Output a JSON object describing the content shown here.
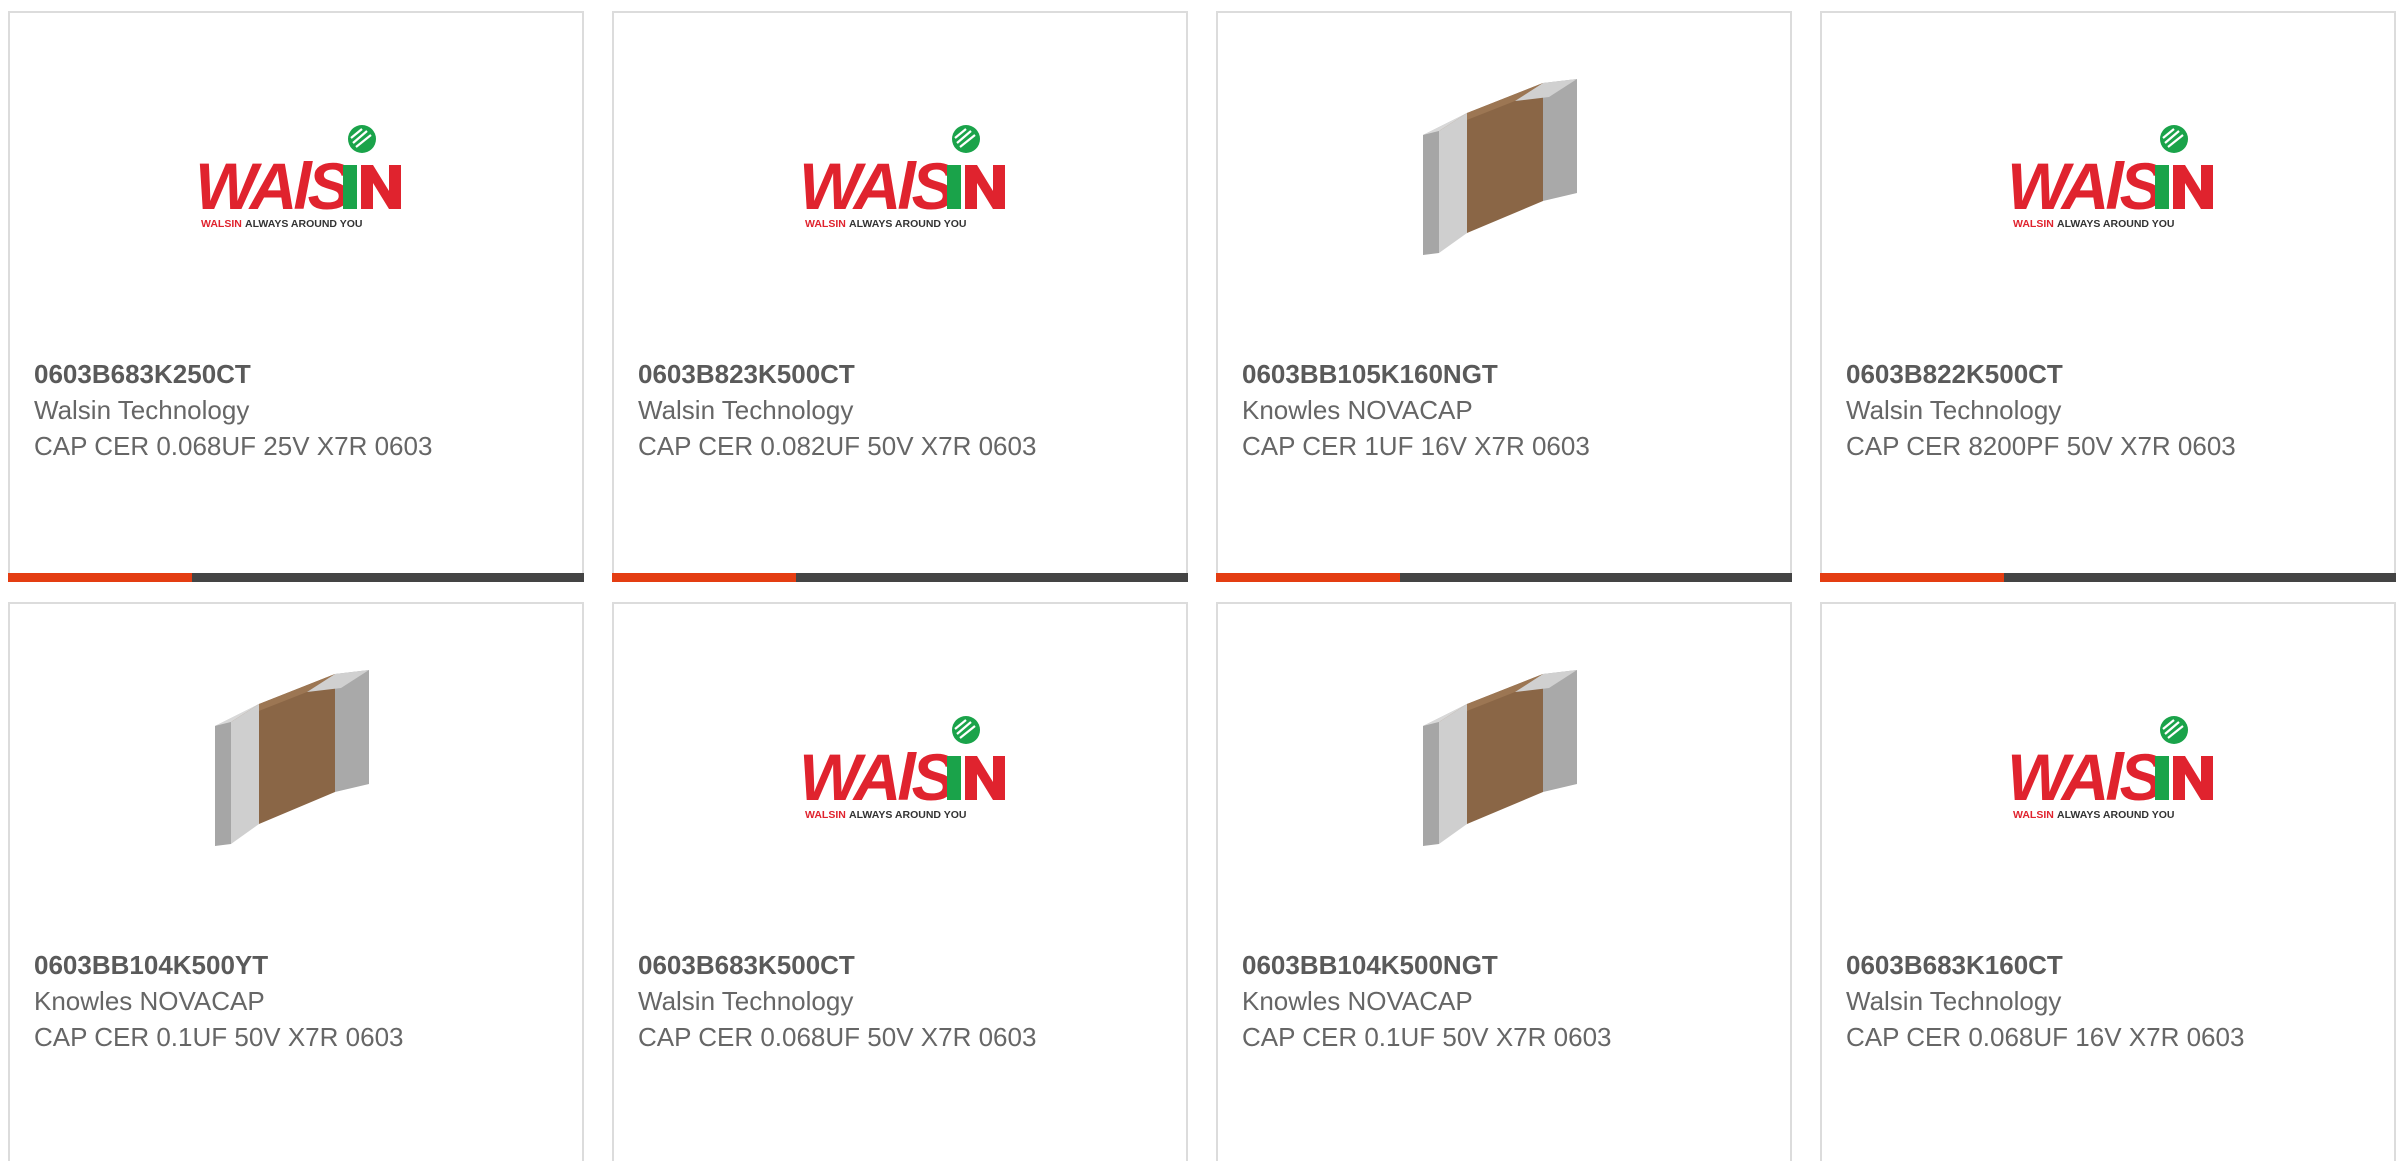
{
  "products": [
    {
      "part": "0603B683K250CT",
      "manufacturer": "Walsin Technology",
      "description": "CAP CER 0.068UF 25V X7R 0603",
      "image": "walsin-logo"
    },
    {
      "part": "0603B823K500CT",
      "manufacturer": "Walsin Technology",
      "description": "CAP CER 0.082UF 50V X7R 0603",
      "image": "walsin-logo"
    },
    {
      "part": "0603BB105K160NGT",
      "manufacturer": "Knowles NOVACAP",
      "description": "CAP CER 1UF 16V X7R 0603",
      "image": "capacitor-chip"
    },
    {
      "part": "0603B822K500CT",
      "manufacturer": "Walsin Technology",
      "description": "CAP CER 8200PF 50V X7R 0603",
      "image": "walsin-logo"
    },
    {
      "part": "0603BB104K500YT",
      "manufacturer": "Knowles NOVACAP",
      "description": "CAP CER 0.1UF 50V X7R 0603",
      "image": "capacitor-chip"
    },
    {
      "part": "0603B683K500CT",
      "manufacturer": "Walsin Technology",
      "description": "CAP CER 0.068UF 50V X7R 0603",
      "image": "walsin-logo"
    },
    {
      "part": "0603BB104K500NGT",
      "manufacturer": "Knowles NOVACAP",
      "description": "CAP CER 0.1UF 50V X7R 0603",
      "image": "capacitor-chip"
    },
    {
      "part": "0603B683K160CT",
      "manufacturer": "Walsin Technology",
      "description": "CAP CER 0.068UF 16V X7R 0603",
      "image": "walsin-logo"
    }
  ],
  "logo": {
    "wordmark": "WALSIN",
    "tagline": "Walsin Always Around You"
  },
  "colors": {
    "accent": "#e43d12",
    "bar": "#444444",
    "walsin_red": "#e0232e",
    "walsin_green": "#1aa34a"
  }
}
